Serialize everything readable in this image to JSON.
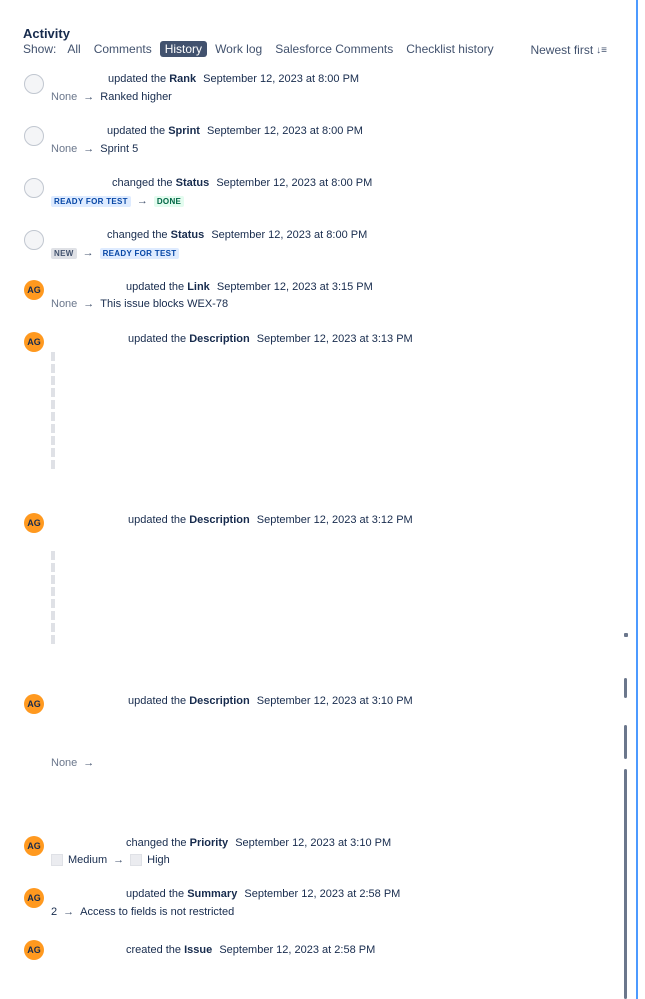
{
  "activity": {
    "heading": "Activity",
    "show_label": "Show:",
    "tabs": [
      "All",
      "Comments",
      "History",
      "Work log",
      "Salesforce Comments",
      "Checklist history"
    ],
    "active_tab": "History",
    "sort_label": "Newest first"
  },
  "entries": [
    {
      "avatar": "",
      "action": "updated the",
      "field": "Rank",
      "timestamp": "September 12, 2023 at 8:00 PM",
      "from": "None",
      "to": "Ranked higher"
    },
    {
      "avatar": "",
      "action": "updated the",
      "field": "Sprint",
      "timestamp": "September 12, 2023 at 8:00 PM",
      "from": "None",
      "to": "Sprint 5"
    },
    {
      "avatar": "",
      "action": "changed the",
      "field": "Status",
      "timestamp": "September 12, 2023 at 8:00 PM",
      "from": "READY FOR TEST",
      "to": "DONE"
    },
    {
      "avatar": "",
      "action": "changed the",
      "field": "Status",
      "timestamp": "September 12, 2023 at 8:00 PM",
      "from": "NEW",
      "to": "READY FOR TEST"
    },
    {
      "avatar": "AG",
      "action": "updated the",
      "field": "Link",
      "timestamp": "September 12, 2023 at 3:15 PM",
      "from": "None",
      "to": "This issue blocks WEX-78"
    },
    {
      "avatar": "AG",
      "action": "updated the",
      "field": "Description",
      "timestamp": "September 12, 2023 at 3:13 PM"
    },
    {
      "avatar": "AG",
      "action": "updated the",
      "field": "Description",
      "timestamp": "September 12, 2023 at 3:12 PM"
    },
    {
      "avatar": "AG",
      "action": "updated the",
      "field": "Description",
      "timestamp": "September 12, 2023 at 3:10 PM",
      "from": "None"
    },
    {
      "avatar": "AG",
      "action": "changed the",
      "field": "Priority",
      "timestamp": "September 12, 2023 at 3:10 PM",
      "from": "Medium",
      "to": "High"
    },
    {
      "avatar": "AG",
      "action": "updated the",
      "field": "Summary",
      "timestamp": "September 12, 2023 at 2:58 PM",
      "from": "2",
      "to": "Access to fields is not restricted"
    },
    {
      "avatar": "AG",
      "action": "created the",
      "field": "Issue",
      "timestamp": "September 12, 2023 at 2:58 PM"
    }
  ],
  "colors": {
    "accent": "#4c9aff",
    "active_tab_bg": "#42526e",
    "avatar_bg": "#ff991f",
    "status_blue": "#0747a6",
    "status_green": "#006644"
  }
}
